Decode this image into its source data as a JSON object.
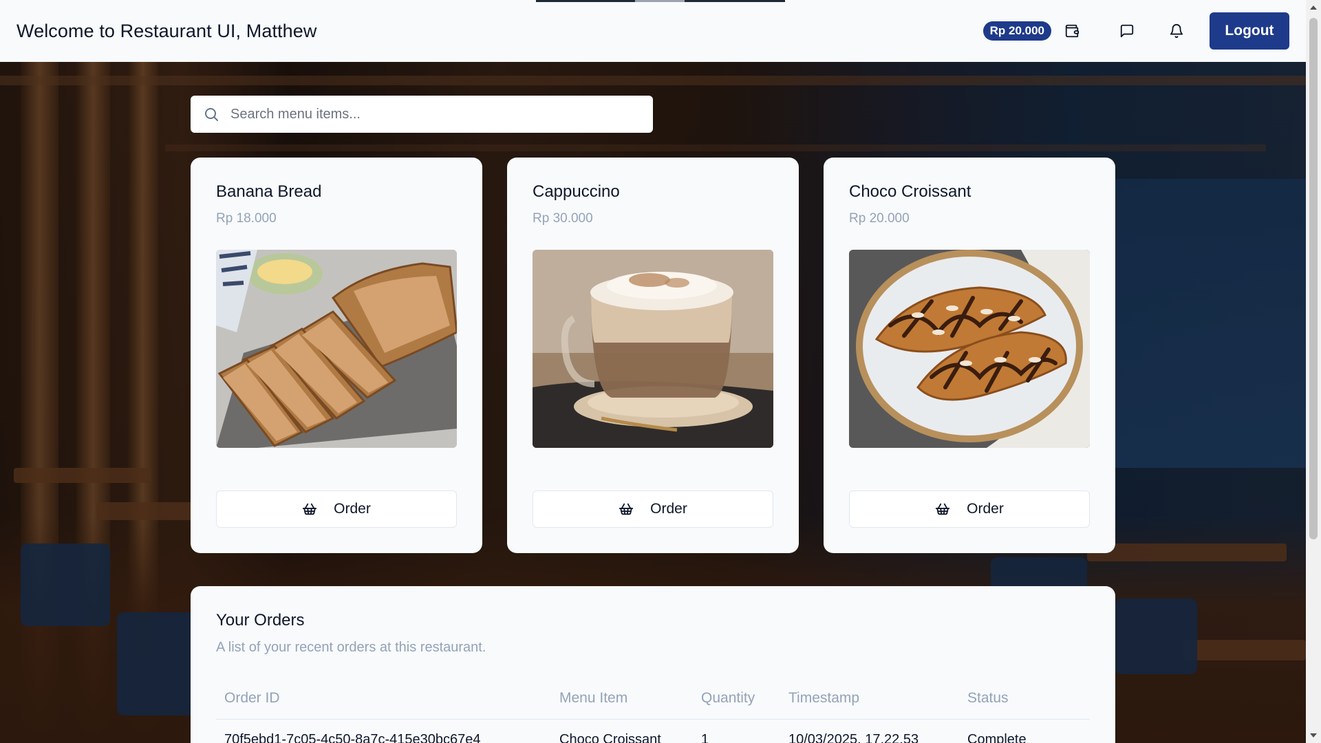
{
  "header": {
    "title": "Welcome to Restaurant UI, Matthew",
    "balance": "Rp 20.000",
    "logout_label": "Logout",
    "icons": [
      "wallet-icon",
      "message-icon",
      "bell-icon"
    ]
  },
  "search": {
    "placeholder": "Search menu items..."
  },
  "menu": {
    "items": [
      {
        "name": "Banana Bread",
        "price": "Rp 18.000",
        "order_label": "Order"
      },
      {
        "name": "Cappuccino",
        "price": "Rp 30.000",
        "order_label": "Order"
      },
      {
        "name": "Choco Croissant",
        "price": "Rp 20.000",
        "order_label": "Order"
      }
    ]
  },
  "orders": {
    "title": "Your Orders",
    "subtitle": "A list of your recent orders at this restaurant.",
    "columns": [
      "Order ID",
      "Menu Item",
      "Quantity",
      "Timestamp",
      "Status"
    ],
    "rows": [
      [
        "70f5ebd1-7c05-4c50-8a7c-415e30bc67e4",
        "Choco Croissant",
        "1",
        "10/03/2025, 17.22.53",
        "Complete"
      ]
    ]
  },
  "colors": {
    "accent": "#1e3a8a",
    "card_bg": "#f8fafc",
    "muted_text": "#94a3b8"
  }
}
